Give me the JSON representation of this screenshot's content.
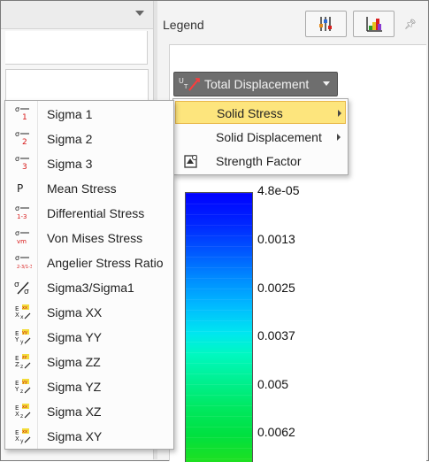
{
  "legend": {
    "title": "Legend",
    "pin_icon": "pin-icon",
    "buttons": [
      {
        "name": "legend-settings-button",
        "icon": "sliders-icon"
      },
      {
        "name": "legend-colors-button",
        "icon": "color-chart-icon"
      }
    ],
    "combo_label": "Total Displacement",
    "colorbar_ticks": [
      "4.8e-05",
      "0.0013",
      "0.0025",
      "0.0037",
      "0.005",
      "0.0062"
    ]
  },
  "submenu": {
    "items": [
      {
        "label": "Solid Stress",
        "highlighted": true,
        "has_submenu": true
      },
      {
        "label": "Solid Displacement",
        "highlighted": false,
        "has_submenu": true
      },
      {
        "label": "Strength Factor",
        "highlighted": false,
        "has_submenu": false,
        "icon": "strength-factor-icon"
      }
    ]
  },
  "menu": {
    "items": [
      {
        "label": "Sigma 1",
        "icon_text": "1"
      },
      {
        "label": "Sigma 2",
        "icon_text": "2"
      },
      {
        "label": "Sigma 3",
        "icon_text": "3"
      },
      {
        "label": "Mean Stress",
        "icon_text": "P"
      },
      {
        "label": "Differential Stress",
        "icon_text": "1-3"
      },
      {
        "label": "Von Mises Stress",
        "icon_text": "vm"
      },
      {
        "label": "Angelier Stress Ratio",
        "icon_text": "2-3/1-3"
      },
      {
        "label": "Sigma3/Sigma1",
        "icon_text": "3/1"
      },
      {
        "label": "Sigma XX",
        "icon_text": "xx"
      },
      {
        "label": "Sigma YY",
        "icon_text": "yy"
      },
      {
        "label": "Sigma ZZ",
        "icon_text": "zz"
      },
      {
        "label": "Sigma YZ",
        "icon_text": "yz"
      },
      {
        "label": "Sigma XZ",
        "icon_text": "xz"
      },
      {
        "label": "Sigma XY",
        "icon_text": "xy"
      }
    ]
  },
  "colors": {
    "highlight": "#fde57d",
    "highlight_border": "#e8b84a",
    "combo_bg": "#6e6e6e",
    "icon_red": "#d81919"
  }
}
